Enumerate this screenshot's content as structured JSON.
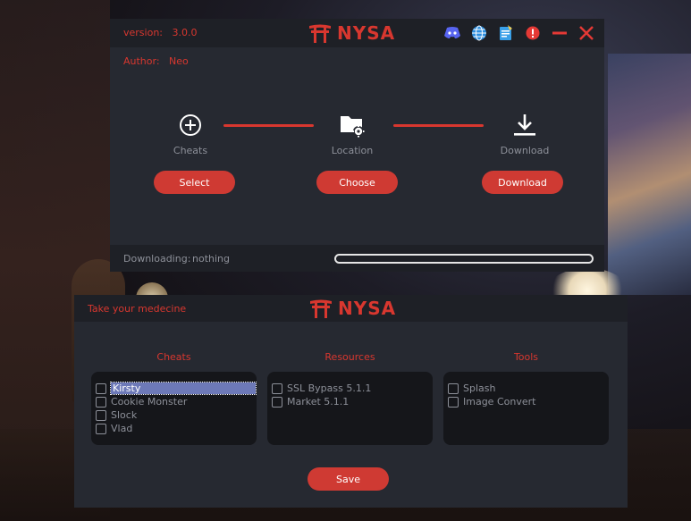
{
  "app": {
    "name": "NYSA",
    "version_label": "version:",
    "version": "3.0.0",
    "author_label": "Author:",
    "author": "Neo"
  },
  "titlebar_icons": [
    "discord-icon",
    "globe-icon",
    "notes-icon",
    "alert-icon",
    "minimize-icon",
    "close-icon"
  ],
  "steps": [
    {
      "label": "Cheats",
      "button": "Select",
      "icon": "plus-circle-icon"
    },
    {
      "label": "Location",
      "button": "Choose",
      "icon": "folder-gear-icon"
    },
    {
      "label": "Download",
      "button": "Download",
      "icon": "download-icon"
    }
  ],
  "status": {
    "label": "Downloading:",
    "value": "nothing",
    "progress": 0
  },
  "config": {
    "tagline": "Take your medecine",
    "save_label": "Save",
    "columns": [
      {
        "title": "Cheats",
        "items": [
          "Kirsty",
          "Cookie Monster",
          "Slock",
          "Vlad"
        ],
        "selected_index": 0
      },
      {
        "title": "Resources",
        "items": [
          "SSL Bypass 5.1.1",
          "Market 5.1.1"
        ]
      },
      {
        "title": "Tools",
        "items": [
          "Splash",
          "Image Convert"
        ]
      }
    ]
  },
  "colors": {
    "accent": "#d8372f",
    "button": "#cf3a33",
    "window": "#262931",
    "titlebar": "#1e2026",
    "panel": "#15161a",
    "muted_text": "#8d9099",
    "selection": "#6d79b8"
  }
}
